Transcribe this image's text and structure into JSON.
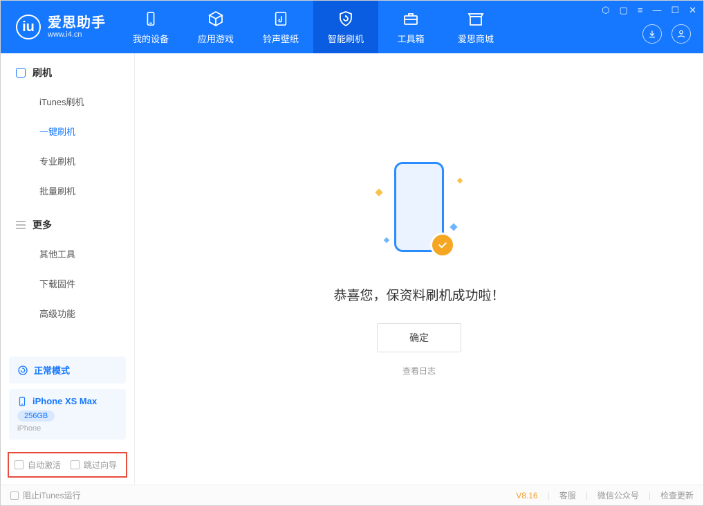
{
  "app": {
    "name": "爱思助手",
    "url": "www.i4.cn"
  },
  "tabs": [
    {
      "label": "我的设备",
      "icon": "device"
    },
    {
      "label": "应用游戏",
      "icon": "cube"
    },
    {
      "label": "铃声壁纸",
      "icon": "music"
    },
    {
      "label": "智能刷机",
      "icon": "shield",
      "active": true
    },
    {
      "label": "工具箱",
      "icon": "toolbox"
    },
    {
      "label": "爱思商城",
      "icon": "store"
    }
  ],
  "sidebar": {
    "group1": {
      "title": "刷机",
      "items": [
        "iTunes刷机",
        "一键刷机",
        "专业刷机",
        "批量刷机"
      ],
      "activeIndex": 1
    },
    "group2": {
      "title": "更多",
      "items": [
        "其他工具",
        "下载固件",
        "高级功能"
      ]
    }
  },
  "mode_box": {
    "label": "正常模式"
  },
  "device": {
    "name": "iPhone XS Max",
    "storage": "256GB",
    "type": "iPhone"
  },
  "bottom_options": {
    "auto_activate": "自动激活",
    "skip_guide": "跳过向导"
  },
  "main": {
    "success_message": "恭喜您，保资料刷机成功啦！",
    "confirm": "确定",
    "view_log": "查看日志"
  },
  "footer": {
    "block_itunes": "阻止iTunes运行",
    "version": "V8.16",
    "links": [
      "客服",
      "微信公众号",
      "检查更新"
    ]
  }
}
